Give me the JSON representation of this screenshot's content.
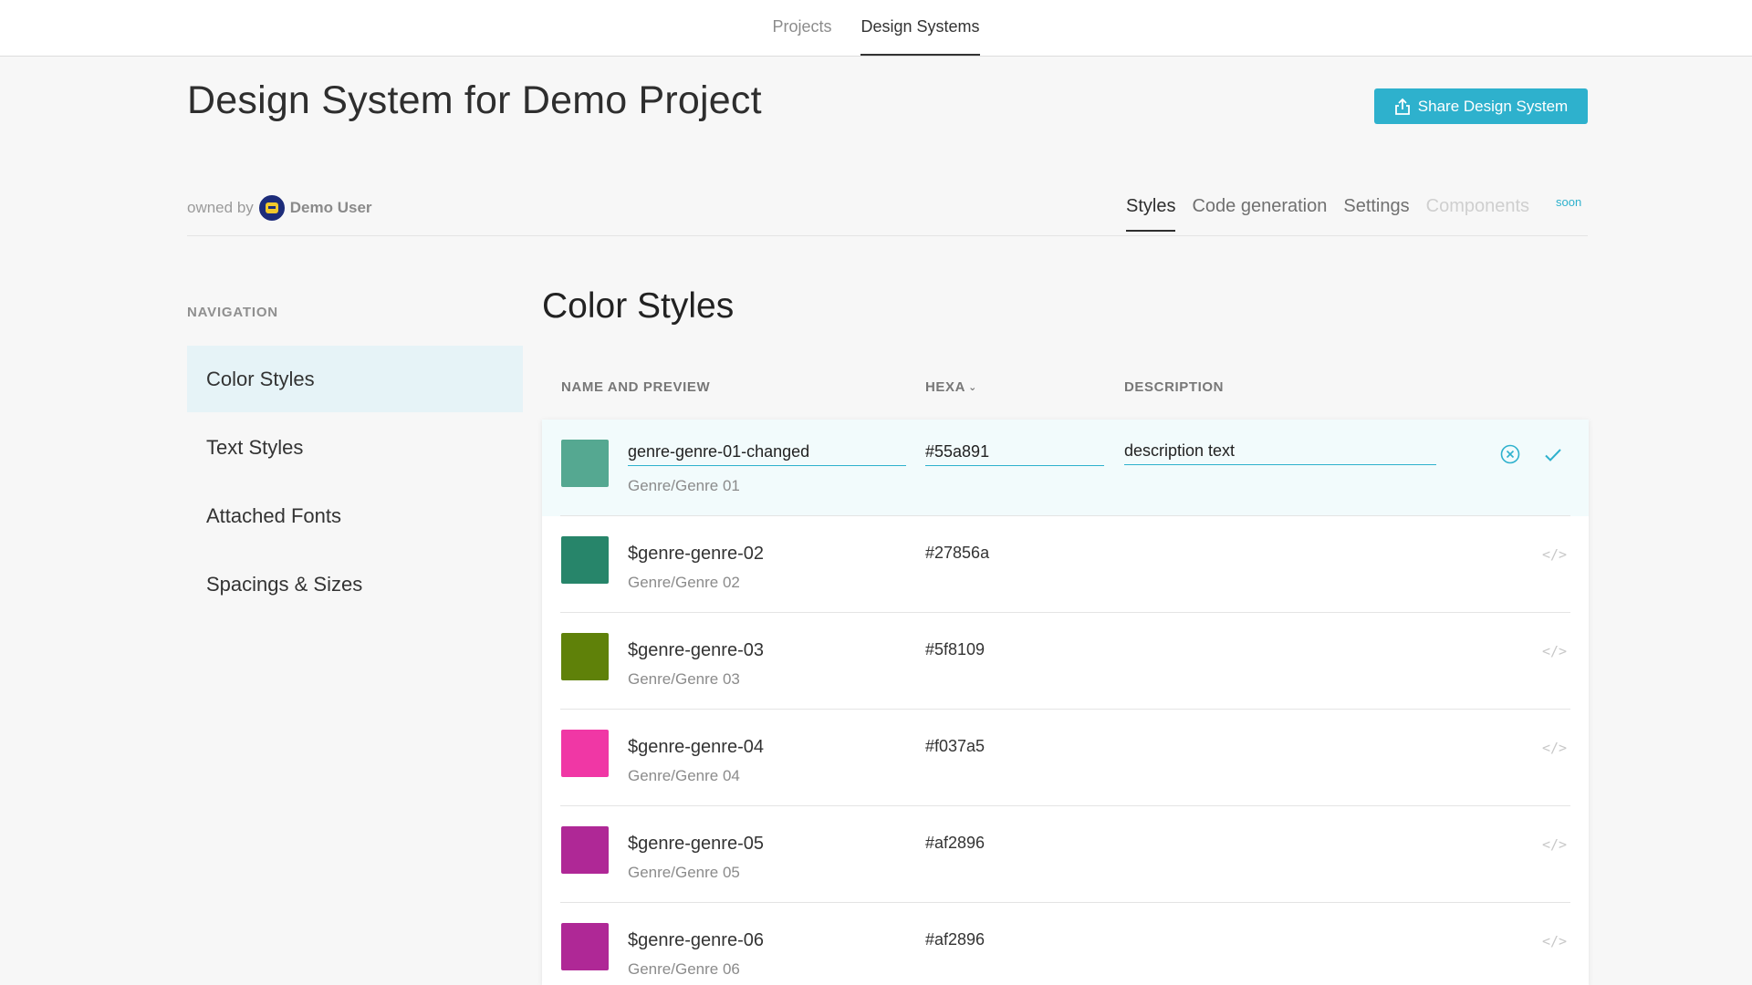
{
  "topnav": {
    "tabs": [
      {
        "label": "Projects"
      },
      {
        "label": "Design Systems"
      }
    ]
  },
  "header": {
    "title": "Design System for Demo Project",
    "share_label": "Share Design System",
    "owned_by": "owned by",
    "owner_name": "Demo User"
  },
  "subtabs": [
    {
      "label": "Styles"
    },
    {
      "label": "Code generation"
    },
    {
      "label": "Settings"
    },
    {
      "label": "Components"
    }
  ],
  "soon_badge": "soon",
  "sidebar": {
    "heading": "NAVIGATION",
    "items": [
      {
        "label": "Color Styles"
      },
      {
        "label": "Text Styles"
      },
      {
        "label": "Attached Fonts"
      },
      {
        "label": "Spacings & Sizes"
      }
    ]
  },
  "main": {
    "title": "Color Styles",
    "columns": {
      "name": "NAME AND PREVIEW",
      "hexa": "HEXA",
      "description": "DESCRIPTION"
    },
    "editing_row": {
      "name_value": "genre-genre-01-changed",
      "path": "Genre/Genre 01",
      "hex_value": "#55a891",
      "description_value": "description text",
      "swatch": "#55a891"
    },
    "rows": [
      {
        "name": "$genre-genre-02",
        "path": "Genre/Genre 02",
        "hex": "#27856a",
        "swatch": "#27856a"
      },
      {
        "name": "$genre-genre-03",
        "path": "Genre/Genre 03",
        "hex": "#5f8109",
        "swatch": "#5f8109"
      },
      {
        "name": "$genre-genre-04",
        "path": "Genre/Genre 04",
        "hex": "#f037a5",
        "swatch": "#f037a5"
      },
      {
        "name": "$genre-genre-05",
        "path": "Genre/Genre 05",
        "hex": "#af2896",
        "swatch": "#af2896"
      },
      {
        "name": "$genre-genre-06",
        "path": "Genre/Genre 06",
        "hex": "#af2896",
        "swatch": "#af2896"
      }
    ],
    "code_icon_text": "</>"
  },
  "colors": {
    "accent": "#2eb1cd",
    "active_nav_bg": "#e6f3f7"
  }
}
